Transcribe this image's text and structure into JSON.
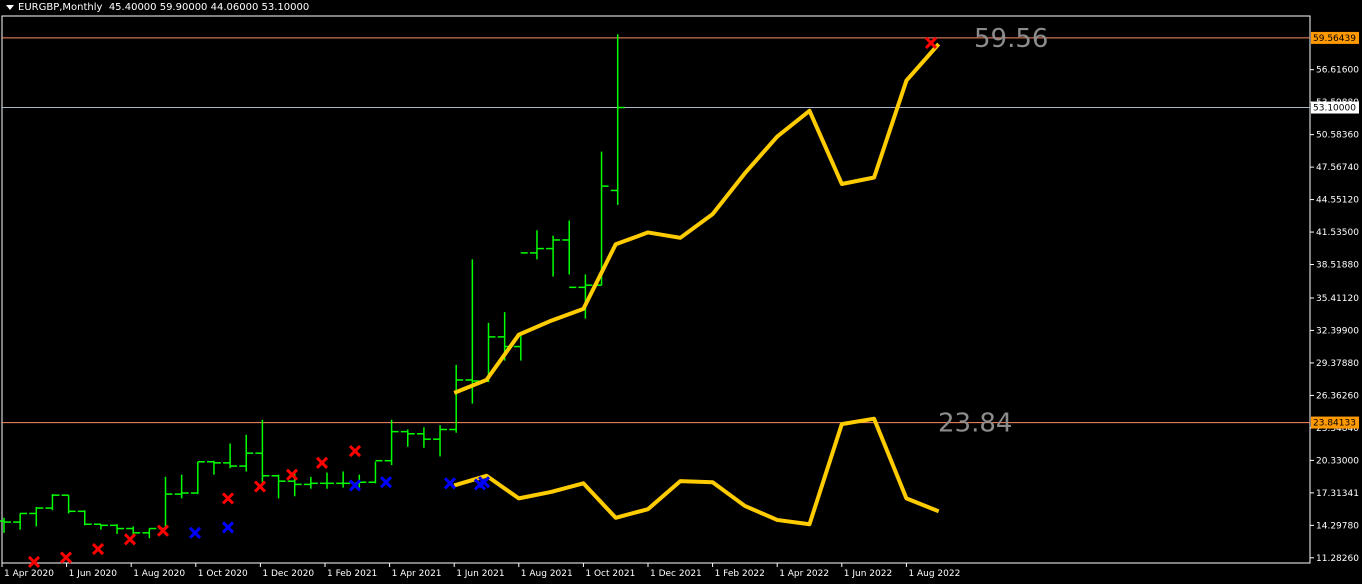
{
  "header": {
    "symbol": "EURGBP,Monthly",
    "ohlc": "45.40000 59.90000 44.06000 53.10000"
  },
  "colors": {
    "background": "#000000",
    "frame": "#ffffff",
    "bar": "#00ff00",
    "envelope": "#ffcc00",
    "marker_up": "#ff0000",
    "marker_down": "#0000ff",
    "hline_level": "#ff8c66",
    "hline_price": "#a9b6c8",
    "annotation": "#8c8c8c"
  },
  "chart_data": {
    "type": "line",
    "title": "",
    "xlabel": "",
    "ylabel": "",
    "ylim": [
      10.8,
      61.6
    ],
    "y_ticks": [
      "11.28260",
      "14.29780",
      "17.31341",
      "20.33000",
      "23.34840",
      "26.36260",
      "29.37880",
      "32.39900",
      "35.41120",
      "38.51880",
      "41.53500",
      "44.55120",
      "47.56740",
      "50.58360",
      "53.59880",
      "56.61600"
    ],
    "x_ticks": [
      "1 Apr 2020",
      "1 Jun 2020",
      "1 Aug 2020",
      "1 Oct 2020",
      "1 Dec 2020",
      "1 Feb 2021",
      "1 Apr 2021",
      "1 Jun 2021",
      "1 Aug 2021",
      "1 Oct 2021",
      "1 Dec 2021",
      "1 Feb 2022",
      "1 Apr 2022",
      "1 Jun 2022",
      "1 Aug 2022"
    ],
    "periods": [
      "Apr 2020",
      "May 2020",
      "Jun 2020",
      "Jul 2020",
      "Aug 2020",
      "Sep 2020",
      "Oct 2020",
      "Nov 2020",
      "Dec 2020",
      "Jan 2021",
      "Feb 2021",
      "Mar 2021",
      "Apr 2021",
      "May 2021",
      "Jun 2021",
      "Jul 2021",
      "Aug 2021",
      "Sep 2021",
      "Oct 2021",
      "Nov 2021",
      "Dec 2021",
      "Jan 2022",
      "Feb 2022",
      "Mar 2022",
      "Apr 2022",
      "May 2022",
      "Jun 2022",
      "Jul 2022",
      "Aug 2022",
      "Sep 2022"
    ],
    "ohlc": [
      [
        14.7,
        15.0,
        13.6,
        14.6
      ],
      [
        14.6,
        15.4,
        13.9,
        15.4
      ],
      [
        15.4,
        16.0,
        14.2,
        15.9
      ],
      [
        15.9,
        17.2,
        15.7,
        17.1
      ],
      [
        17.1,
        17.1,
        15.4,
        15.6
      ],
      [
        15.6,
        15.7,
        14.3,
        14.4
      ],
      [
        14.4,
        14.4,
        13.9,
        14.3
      ],
      [
        14.3,
        14.4,
        13.5,
        14.0
      ],
      [
        14.0,
        14.2,
        13.3,
        13.6
      ],
      [
        13.6,
        14.0,
        13.1,
        14.0
      ],
      [
        14.0,
        18.8,
        14.0,
        17.2
      ],
      [
        17.2,
        19.0,
        16.8,
        17.3
      ],
      [
        17.3,
        20.2,
        17.2,
        20.2
      ],
      [
        20.2,
        20.3,
        19.0,
        20.1
      ],
      [
        20.1,
        21.9,
        19.6,
        19.8
      ],
      [
        19.8,
        22.7,
        19.3,
        21.0
      ],
      [
        21.0,
        24.1,
        18.3,
        18.9
      ],
      [
        18.9,
        19.0,
        16.8,
        18.4
      ],
      [
        18.4,
        19.1,
        17.0,
        18.1
      ],
      [
        18.1,
        18.8,
        17.7,
        18.2
      ],
      [
        18.2,
        19.2,
        17.7,
        18.2
      ],
      [
        18.2,
        19.3,
        17.8,
        18.2
      ],
      [
        18.2,
        19.0,
        17.8,
        18.3
      ],
      [
        18.3,
        20.2,
        18.2,
        20.3
      ],
      [
        20.3,
        24.1,
        19.9,
        23.0
      ],
      [
        23.0,
        23.2,
        21.6,
        22.8
      ],
      [
        22.8,
        23.4,
        21.5,
        22.3
      ],
      [
        22.3,
        23.6,
        20.7,
        23.2
      ],
      [
        23.2,
        29.2,
        22.9,
        27.8
      ],
      [
        27.8,
        39.0,
        25.6,
        27.7
      ],
      [
        27.7,
        33.1,
        27.6,
        31.8
      ],
      [
        31.8,
        34.1,
        29.6,
        30.9
      ],
      [
        30.9,
        32.1,
        29.6,
        39.6
      ],
      [
        39.6,
        41.7,
        39.0,
        40.0
      ],
      [
        40.0,
        41.2,
        37.4,
        40.8
      ],
      [
        40.8,
        42.6,
        37.6,
        36.4
      ],
      [
        36.4,
        37.6,
        33.5,
        36.6
      ],
      [
        36.6,
        49.0,
        36.6,
        45.8
      ],
      [
        45.4,
        59.9,
        44.06,
        53.1
      ]
    ],
    "series": [
      {
        "values_upper": [
          26.6,
          27.8,
          32.0,
          33.3,
          34.4,
          40.4,
          41.5,
          41.0,
          43.2,
          47.0,
          50.4,
          52.8,
          46.0,
          46.6,
          55.6,
          59.0
        ]
      },
      {
        "values_lower": [
          18.0,
          18.9,
          16.8,
          17.4,
          18.2,
          15.0,
          15.8,
          18.4,
          18.3,
          16.1,
          14.8,
          14.4,
          23.7,
          24.2,
          16.8,
          15.6
        ]
      }
    ],
    "up_markers": [
      10.9,
      11.3,
      12.1,
      13.0,
      13.8,
      16.8,
      17.9,
      19.0,
      20.1,
      21.2,
      59.1
    ],
    "down_markers": [
      13.6,
      14.1,
      18.0,
      18.3,
      18.2,
      18.1,
      18.3
    ],
    "hlines": [
      {
        "value": 59.56439,
        "label": "59.56439"
      },
      {
        "value": 53.1,
        "label": "53.10000"
      },
      {
        "value": 23.84133,
        "label": "23.84133"
      }
    ],
    "annotations": [
      {
        "text": "59.56",
        "value": 59.56
      },
      {
        "text": "23.84",
        "value": 23.84
      }
    ]
  }
}
